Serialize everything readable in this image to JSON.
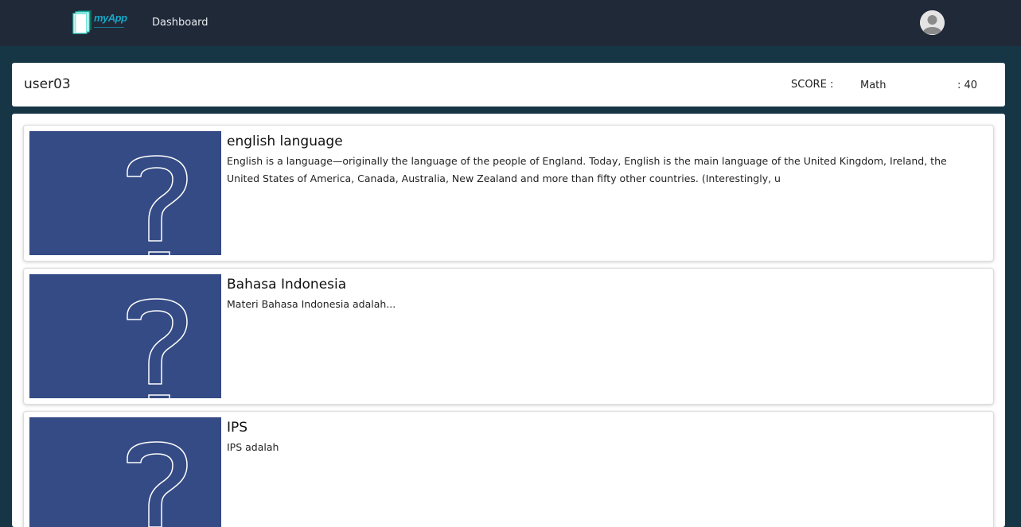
{
  "navbar": {
    "logo_text": "myApp",
    "dashboard_label": "Dashboard",
    "avatar_icon": "user-avatar-icon"
  },
  "user_bar": {
    "username": "user03",
    "score_label": "SCORE :",
    "score_subject": "Math",
    "score_value": ": 40"
  },
  "courses": [
    {
      "title": "english language",
      "description": "English is a language—originally the language of the people of England. Today, English is the main language of the United Kingdom, Ireland, the United States of America, Canada, Australia, New Zealand and more than fifty other countries. (Interestingly, u",
      "thumbnail_icon": "question-mark-icon"
    },
    {
      "title": "Bahasa Indonesia",
      "description": "Materi Bahasa Indonesia adalah...",
      "thumbnail_icon": "question-mark-icon"
    },
    {
      "title": "IPS",
      "description": "IPS adalah",
      "thumbnail_icon": "question-mark-icon"
    }
  ],
  "colors": {
    "navbar_bg": "#202938",
    "page_bg": "#163545",
    "thumbnail_bg": "#354b85",
    "logo_accent": "#17a9c9"
  }
}
